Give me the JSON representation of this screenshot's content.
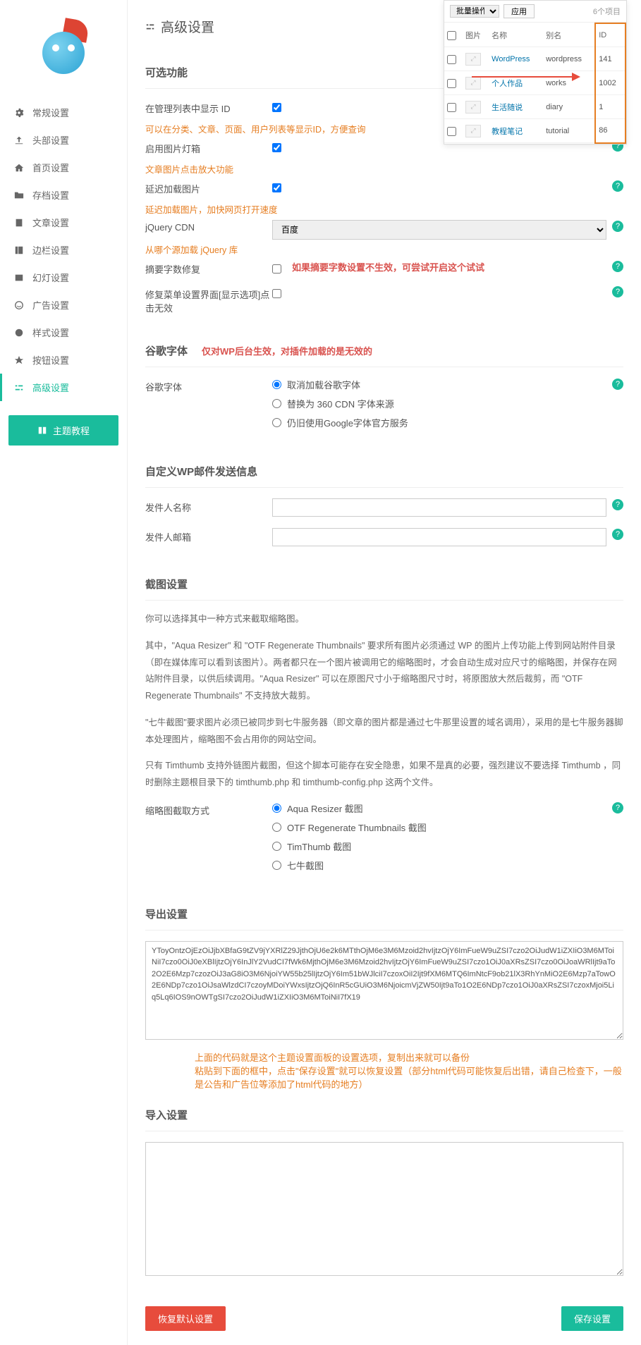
{
  "header": {
    "title": "高级设置",
    "save_btn": "保存设置",
    "reset_btn": "恢复默认设置"
  },
  "sidebar": {
    "items": [
      {
        "label": "常规设置"
      },
      {
        "label": "头部设置"
      },
      {
        "label": "首页设置"
      },
      {
        "label": "存档设置"
      },
      {
        "label": "文章设置"
      },
      {
        "label": "边栏设置"
      },
      {
        "label": "幻灯设置"
      },
      {
        "label": "广告设置"
      },
      {
        "label": "样式设置"
      },
      {
        "label": "按钮设置"
      },
      {
        "label": "高级设置"
      }
    ],
    "tutorial_btn": "主题教程"
  },
  "overlay": {
    "batch": "批量操作",
    "apply": "应用",
    "count": "6个项目",
    "cols": {
      "img": "图片",
      "name": "名称",
      "alias": "别名",
      "id": "ID"
    },
    "rows": [
      {
        "name": "WordPress",
        "alias": "wordpress",
        "id": "141"
      },
      {
        "name": "个人作品",
        "alias": "works",
        "id": "1002"
      },
      {
        "name": "生活随说",
        "alias": "diary",
        "id": "1"
      },
      {
        "name": "教程笔记",
        "alias": "tutorial",
        "id": "86"
      }
    ]
  },
  "optional": {
    "title": "可选功能",
    "show_id": {
      "label": "在管理列表中显示 ID",
      "hint": "可以在分类、文章、页面、用户列表等显示ID，方便查询"
    },
    "lightbox": {
      "label": "启用图片灯箱",
      "hint": "文章图片点击放大功能"
    },
    "lazyload": {
      "label": "延迟加载图片",
      "hint": "延迟加载图片，加快网页打开速度"
    },
    "jquery": {
      "label": "jQuery CDN",
      "value": "百度",
      "hint": "从哪个源加载 jQuery 库"
    },
    "excerpt": {
      "label": "摘要字数修复",
      "note": "如果摘要字数设置不生效，可尝试开启这个试试"
    },
    "menu_fix": {
      "label": "修复菜单设置界面[显示选项]点击无效"
    }
  },
  "gfonts": {
    "title": "谷歌字体",
    "note": "仅对WP后台生效，对插件加载的是无效的",
    "label": "谷歌字体",
    "opts": [
      "取消加载谷歌字体",
      "替换为 360 CDN 字体来源",
      "仍旧使用Google字体官方服务"
    ]
  },
  "mail": {
    "title": "自定义WP邮件发送信息",
    "name": "发件人名称",
    "email": "发件人邮箱"
  },
  "thumb": {
    "title": "截图设置",
    "p1": "你可以选择其中一种方式来截取缩略图。",
    "p2": "其中，\"Aqua Resizer\" 和 \"OTF Regenerate Thumbnails\" 要求所有图片必须通过 WP 的图片上传功能上传到网站附件目录（即在媒体库可以看到该图片）。两者都只在一个图片被调用它的缩略图时，才会自动生成对应尺寸的缩略图，并保存在网站附件目录，以供后续调用。\"Aqua Resizer\" 可以在原图尺寸小于缩略图尺寸时，将原图放大然后裁剪，而 \"OTF Regenerate Thumbnails\" 不支持放大裁剪。",
    "p3": "\"七牛截图\"要求图片必须已被同步到七牛服务器（即文章的图片都是通过七牛那里设置的域名调用），采用的是七牛服务器脚本处理图片，缩略图不会占用你的网站空间。",
    "p4": "只有 Timthumb 支持外链图片截图，但这个脚本可能存在安全隐患，如果不是真的必要，强烈建议不要选择 Timthumb ，同时删除主题根目录下的 timthumb.php 和 timthumb-config.php 这两个文件。",
    "label": "缩略图截取方式",
    "opts": [
      "Aqua Resizer 截图",
      "OTF Regenerate Thumbnails 截图",
      "TimThumb 截图",
      "七牛截图"
    ]
  },
  "export": {
    "title": "导出设置",
    "value": "YToyOntzOjEzOiJjbXBfaG9tZV9jYXRlZ29JjthOjU6e2k6MTthOjM6e3M6Mzoid2hvIjtzOjY6ImFueW9uZSI7czo2OiJudW1iZXIiO3M6MToiNiI7czo0OiJ0eXBlIjtzOjY6InJlY2VudCI7fWk6MjthOjM6e3M6Mzoid2hvIjtzOjY6ImFueW9uZSI7czo1OiJ0aXRsZSI7czo0OiJoaWRlIjt9aTo2O2E6Mzp7czozOiJ3aG8iO3M6NjoiYW55b25lIjtzOjY6Im51bWJlciI7czoxOiI2Ijt9fXM6MTQ6ImNtcF9ob21lX3RhYnMiO2E6Mzp7aTowO2E6NDp7czo1OiJsaWlzdCI7czoyMDoiYWxsIjtzOjQ6InR5cGUiO3M6NjoicmVjZW50Ijt9aTo1O2E6NDp7czo1OiJ0aXRsZSI7czoxMjoi5Liq5Lq6IOS9nOWTgSI7czo2OiJudW1iZXIiO3M6MToiNiI7fX19",
    "import_hint": "上面的代码就是这个主题设置面板的设置选项，复制出来就可以备份\n粘贴到下面的框中，点击\"保存设置\"就可以恢复设置（部分html代码可能恢复后出错，请自己检查下，一般是公告和广告位等添加了html代码的地方）"
  },
  "import": {
    "title": "导入设置"
  }
}
